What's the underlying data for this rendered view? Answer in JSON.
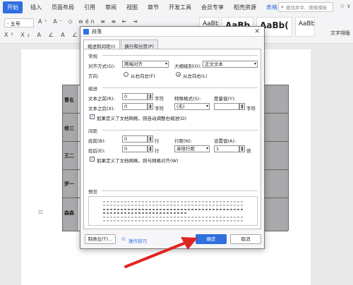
{
  "menubar": {
    "start": "开始",
    "items": [
      "插入",
      "页面布局",
      "引用",
      "审阅",
      "视图",
      "章节",
      "开发工具",
      "会员专享",
      "稻壳资源"
    ],
    "extra": "表格工",
    "search_placeholder": "查找命令、搜索模板"
  },
  "toolbar": {
    "font_size": "- 五号",
    "style1": "AaBbCcDd",
    "style2": "AaBb",
    "style3": "AaBb(",
    "style4": "AaBbC",
    "text_layout": "文字排版"
  },
  "document": {
    "names": [
      "曹名",
      "修三",
      "王二",
      "罗一",
      "森森"
    ]
  },
  "dialog": {
    "title": "段落",
    "tabs": [
      "缩进和间距(I)",
      "换行和分页(P)"
    ],
    "sections": {
      "general": "常规",
      "indent": "缩进",
      "spacing": "间距",
      "preview": "预览"
    },
    "general": {
      "align_label": "对齐方式(G):",
      "align_value": "两端对齐",
      "outline_label": "大纲级别(O):",
      "outline_value": "正文文本",
      "direction_label": "方向:",
      "rtl": "从右向左(F)",
      "ltr": "从左向右(L)"
    },
    "indent": {
      "before_label": "文本之前(R):",
      "before_value": "0",
      "before_unit": "字符",
      "after_label": "文本之后(X):",
      "after_value": "0",
      "after_unit": "字符",
      "special_label": "特殊格式(S):",
      "special_value": "(无)",
      "measure_label": "度量值(Y):",
      "measure_unit": "字符",
      "grid_check": "如果定义了文档网格，则自动调整右缩进(D)"
    },
    "spacing": {
      "before_label": "段前(B):",
      "before_value": "0",
      "before_unit": "行",
      "after_label": "段后(E):",
      "after_value": "0",
      "after_unit": "行",
      "line_label": "行距(N):",
      "line_value": "单倍行距",
      "setting_label": "设置值(A):",
      "setting_value": "1",
      "setting_unit": "倍",
      "grid_check": "如果定义了文档网格，则与网格对齐(W)"
    },
    "buttons": {
      "tabs": "制表位(T)...",
      "tips": "操作技巧",
      "ok": "确定",
      "cancel": "取消"
    }
  }
}
